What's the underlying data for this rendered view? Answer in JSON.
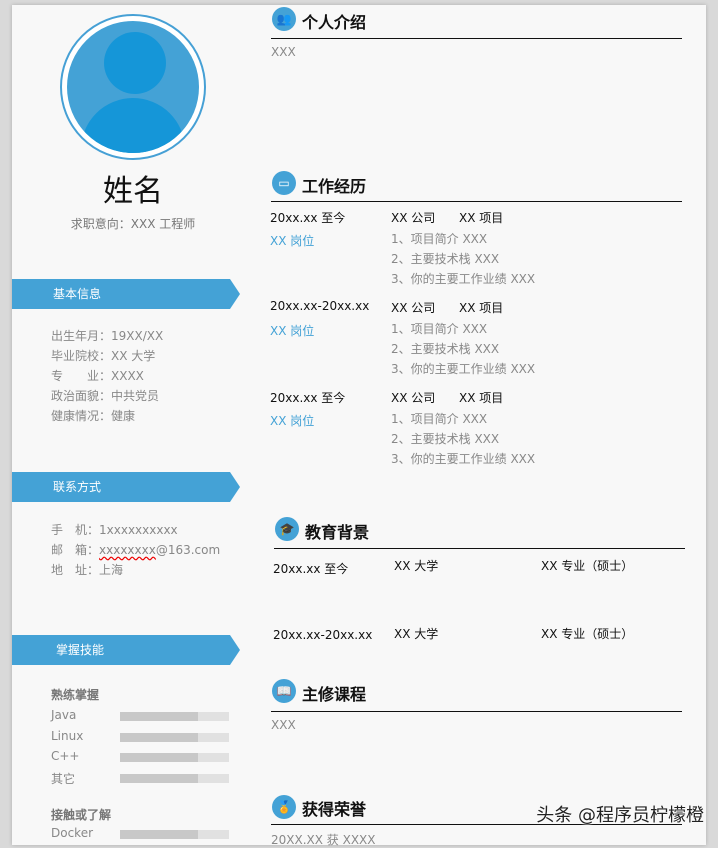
{
  "profile": {
    "name": "姓名",
    "intent": "求职意向：XXX 工程师"
  },
  "basic": {
    "title": "基本信息",
    "lines": [
      "出生年月：19XX/XX",
      "毕业院校：XX 大学",
      "专　　业：XXXX",
      "政治面貌：中共党员",
      "健康情况：健康"
    ]
  },
  "contact": {
    "title": "联系方式",
    "phone": "手　机：1xxxxxxxxxx",
    "email_label": "邮　箱：",
    "email_user": "xxxxxxxx",
    "email_domain": "@163.com",
    "address": "地　址：上海"
  },
  "skills": {
    "title": "掌握技能",
    "proficient_title": "熟练掌握",
    "proficient": [
      {
        "name": "Java",
        "level": 0.72
      },
      {
        "name": "Linux",
        "level": 0.72
      },
      {
        "name": "C++",
        "level": 0.72
      },
      {
        "name": "其它",
        "level": 0.72
      }
    ],
    "familiar_title": "接触或了解",
    "familiar": [
      {
        "name": "Docker",
        "level": 0.72
      }
    ]
  },
  "intro": {
    "title": "个人介绍",
    "text": "XXX"
  },
  "work": {
    "title": "工作经历",
    "entries": [
      {
        "period": "20xx.xx  至今",
        "role": "XX 岗位",
        "company": "XX 公司",
        "project": "XX 项目",
        "items": [
          "1、项目简介 XXX",
          "2、主要技术栈 XXX",
          "3、你的主要工作业绩 XXX"
        ]
      },
      {
        "period": "20xx.xx-20xx.xx",
        "role": "XX 岗位",
        "company": "XX 公司",
        "project": "XX 项目",
        "items": [
          "1、项目简介 XXX",
          "2、主要技术栈 XXX",
          "3、你的主要工作业绩 XXX"
        ]
      },
      {
        "period": "20xx.xx 至今",
        "role": "XX 岗位",
        "company": "XX 公司",
        "project": "XX 项目",
        "items": [
          "1、项目简介 XXX",
          "2、主要技术栈 XXX",
          "3、你的主要工作业绩 XXX"
        ]
      }
    ]
  },
  "education": {
    "title": "教育背景",
    "rows": [
      {
        "period": "20xx.xx 至今",
        "school": "XX 大学",
        "major": "XX 专业（硕士）"
      },
      {
        "period": "20xx.xx-20xx.xx",
        "school": "XX 大学",
        "major": "XX 专业（硕士）"
      }
    ]
  },
  "courses": {
    "title": "主修课程",
    "text": "XXX"
  },
  "honors": {
    "title": "获得荣誉",
    "text": "20XX.XX 获 XXXX"
  },
  "watermark": "头条 @程序员柠檬橙",
  "colors": {
    "accent": "#44a2d6",
    "avatar": "#1596d8"
  }
}
